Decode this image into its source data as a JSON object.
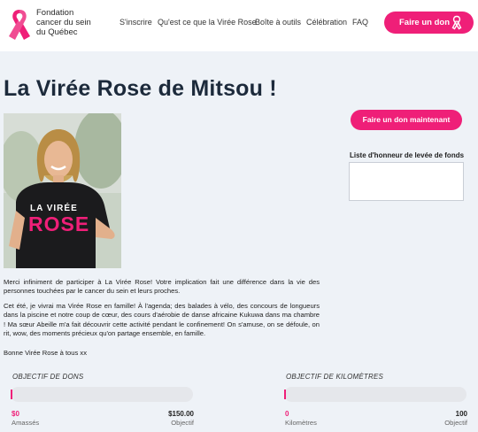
{
  "header": {
    "org_line1": "Fondation",
    "org_line2": "cancer du sein",
    "org_line3": "du Québec",
    "nav": [
      "S'inscrire",
      "Qu'est ce que la Virée Rose",
      "Boîte à outils",
      "Célébration",
      "FAQ"
    ],
    "donate_label": "Faire un don"
  },
  "page": {
    "title": "La Virée Rose de Mitsou !",
    "photo_shirt_line1": "LA VIRÉE",
    "photo_shirt_line2": "ROSE",
    "donate_main_label": "Faire un don maintenant",
    "honor_roll_label": "Liste d'honneur de levée de fonds",
    "paragraphs": [
      "Merci infiniment de participer à La Virée Rose! Votre implication fait une différence dans la vie des personnes touchées par le cancer du sein et leurs proches.",
      "Cet été, je vivrai ma Virée Rose en famille! À l'agenda; des balades à vélo, des concours de longueurs dans la piscine et notre coup de cœur, des cours d'aérobie de danse africaine Kukuwa dans ma chambre ! Ma sœur Abeille m'a fait découvrir cette activité pendant le confinement! On s'amuse, on se défoule, on rit, wow, des moments précieux qu'on partage ensemble, en famille.",
      "Bonne Virée Rose à tous xx"
    ]
  },
  "goals": {
    "donations": {
      "label": "OBJECTIF DE DONS",
      "raised": "$0",
      "raised_caption": "Amassés",
      "target": "$150.00",
      "target_caption": "Objectif",
      "progress_fraction": 0
    },
    "kilometers": {
      "label": "OBJECTIF DE KILOMÈTRES",
      "raised": "0",
      "raised_caption": "Kilomètres",
      "target": "100",
      "target_caption": "Objectif",
      "progress_fraction": 0
    }
  },
  "colors": {
    "brand_pink": "#ef1f78",
    "title_navy": "#1c2a3b",
    "background": "#eef2f7"
  },
  "icons": [
    "pink-ribbon-icon",
    "ribbon-outline-icon"
  ]
}
